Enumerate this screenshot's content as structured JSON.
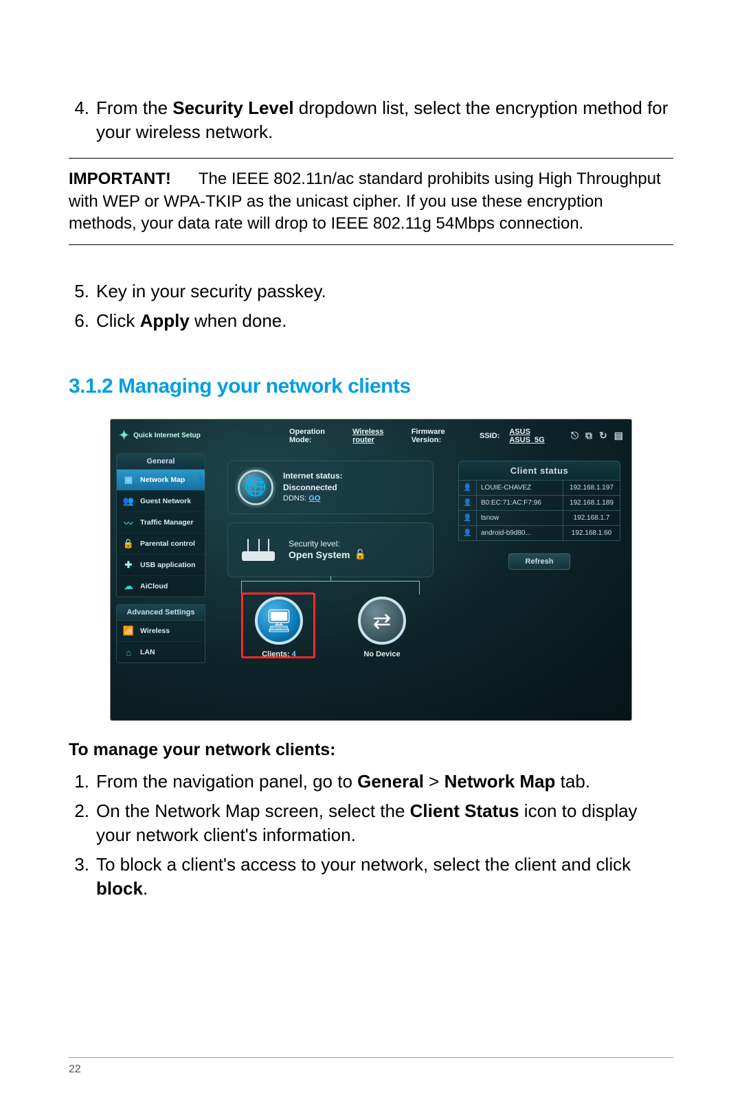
{
  "page_number": "22",
  "steps_top": [
    {
      "num": "4.",
      "text_pre": "From the ",
      "bold1": "Security Level",
      "text_mid": " dropdown list, select the encryption method for your wireless network."
    }
  ],
  "important": {
    "label": "IMPORTANT!",
    "text": "The IEEE 802.11n/ac standard prohibits using High Throughput with WEP or WPA-TKIP as the unicast cipher. If you use these encryption methods, your data rate will drop to IEEE 802.11g 54Mbps connection."
  },
  "steps_mid": [
    {
      "num": "5.",
      "text": "Key in your security passkey."
    },
    {
      "num": "6.",
      "text_pre": "Click ",
      "bold1": "Apply",
      "text_post": " when done."
    }
  ],
  "section_heading": "3.1.2  Managing your network clients",
  "subheading": "To manage your network clients:",
  "steps_bottom": [
    {
      "num": "1.",
      "pre": "From the navigation panel, go to ",
      "b1": "General",
      "mid1": " > ",
      "b2": "Network Map",
      "post": " tab."
    },
    {
      "num": "2.",
      "pre": "On the Network Map screen, select the ",
      "b1": "Client Status",
      "post": " icon to display your network client's information."
    },
    {
      "num": "3.",
      "pre": "To block a client's access to your network, select the client and click ",
      "b1": "block",
      "post": "."
    }
  ],
  "router": {
    "topbar": {
      "op_mode_label": "Operation Mode:",
      "op_mode_value": "Wireless router",
      "fw_label": "Firmware Version:",
      "ssid_label": "SSID:",
      "ssid_value": "ASUS  ASUS_5G"
    },
    "qis": "Quick Internet Setup",
    "nav": {
      "general_header": "General",
      "items": [
        "Network Map",
        "Guest Network",
        "Traffic Manager",
        "Parental control",
        "USB application",
        "AiCloud"
      ],
      "adv_header": "Advanced Settings",
      "adv_items": [
        "Wireless",
        "LAN"
      ]
    },
    "status": {
      "label": "Internet status:",
      "value": "Disconnected",
      "ddns_label": "DDNS:",
      "ddns_go": "GO"
    },
    "security": {
      "label": "Security level:",
      "value": "Open System"
    },
    "tiles": {
      "clients_label": "Clients:",
      "clients_count": "4",
      "usb_label": "No Device"
    },
    "clients": {
      "header": "Client status",
      "rows": [
        {
          "name": "LOUIE-CHAVEZ",
          "ip": "192.168.1.197"
        },
        {
          "name": "B0:EC:71:AC:F7:96",
          "ip": "192.168.1.189"
        },
        {
          "name": "tsnow",
          "ip": "192.168.1.7"
        },
        {
          "name": "android-b9d80...",
          "ip": "192.168.1.60"
        }
      ],
      "refresh": "Refresh"
    }
  }
}
